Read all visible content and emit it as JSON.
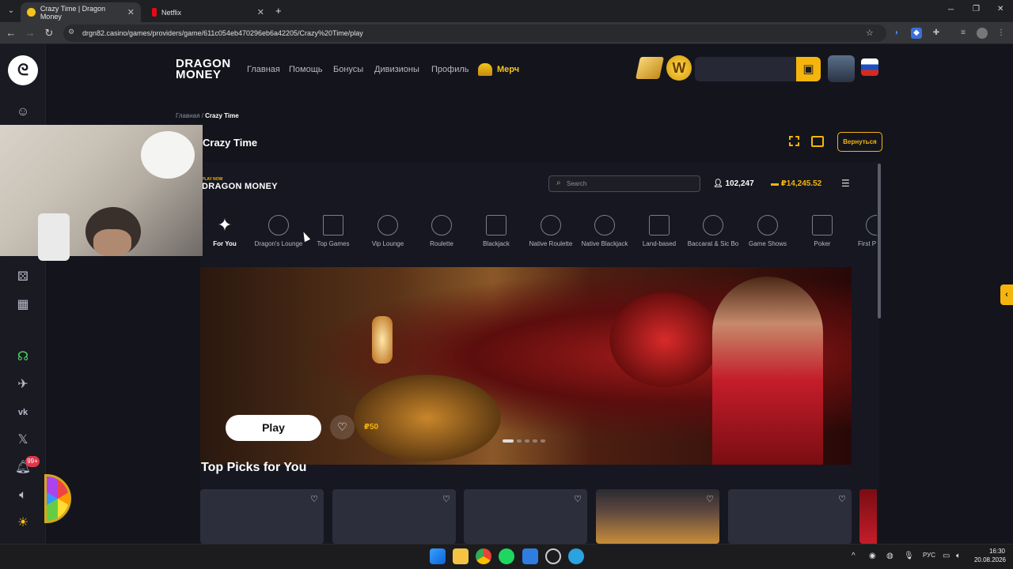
{
  "browser": {
    "tabs": [
      {
        "title": "Crazy Time | Dragon Money",
        "active": true
      },
      {
        "title": "Netflix",
        "active": false
      }
    ],
    "new_tab": "+",
    "url": "drgn82.casino/games/providers/game/611c054eb470296eb6a42205/Crazy%20Time/play"
  },
  "header": {
    "logo_line1": "DRAGON",
    "logo_line2": "MONEY",
    "nav": [
      "Главная",
      "Помощь",
      "Бонусы",
      "Дивизионы",
      "Профиль"
    ],
    "merch_label": "Мерч",
    "coin_letter": "W"
  },
  "sidebar": {
    "notification_badge": "99+"
  },
  "breadcrumb": {
    "home": "Главная",
    "separator": "/",
    "current": "Crazy Time"
  },
  "game": {
    "title": "Crazy Time",
    "back_label": "Вернуться"
  },
  "lobby": {
    "logo_tagline": "PLAY NOW",
    "logo": "DRAGON MONEY",
    "search_placeholder": "Search",
    "players": "102,247",
    "balance": "₽14,245.52",
    "categories": [
      {
        "label": "For You"
      },
      {
        "label": "Dragon's Lounge"
      },
      {
        "label": "Top Games"
      },
      {
        "label": "Vip Lounge"
      },
      {
        "label": "Roulette"
      },
      {
        "label": "Blackjack"
      },
      {
        "label": "Native Roulette"
      },
      {
        "label": "Native Blackjack"
      },
      {
        "label": "Land-based"
      },
      {
        "label": "Baccarat & Sic Bo"
      },
      {
        "label": "Game Shows"
      },
      {
        "label": "Poker"
      },
      {
        "label": "First P"
      }
    ],
    "hero": {
      "play_label": "Play",
      "min_bet": "₽50"
    },
    "top_picks_title": "Top Picks for You"
  },
  "taskbar": {
    "lang": "РУС",
    "time": "16:30",
    "date": "20.08.2026"
  },
  "colors": {
    "accent": "#f5b50c",
    "background": "#14151c",
    "rail": "#191a22"
  }
}
